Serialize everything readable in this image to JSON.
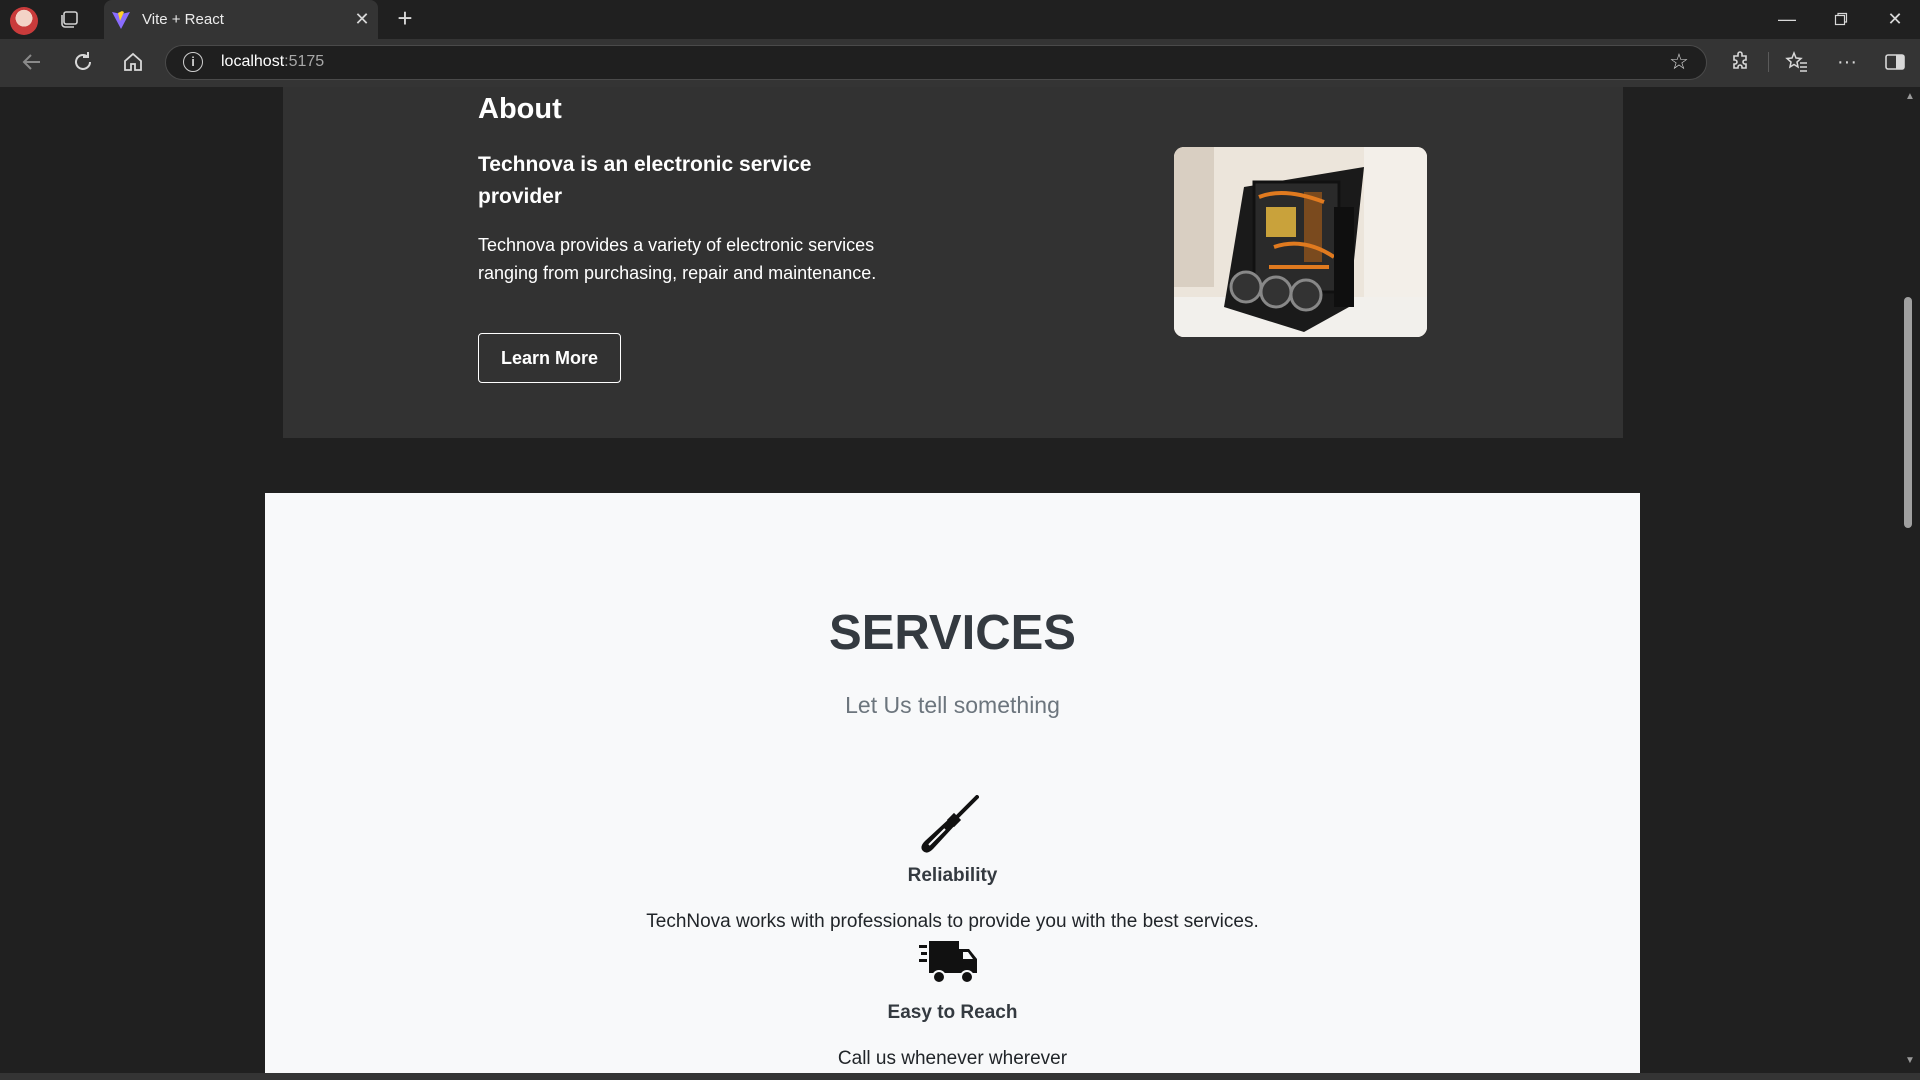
{
  "browser": {
    "tab_title": "Vite + React",
    "url_host": "localhost",
    "url_port": ":5175",
    "icons": [
      "profile-avatar",
      "tab-actions-icon",
      "vite-favicon",
      "close-icon",
      "plus-icon",
      "minimize-icon",
      "restore-icon",
      "window-close-icon",
      "back-arrow-icon",
      "refresh-icon",
      "home-icon",
      "info-icon",
      "star-icon",
      "extensions-icon",
      "favorites-icon",
      "more-icon",
      "sidebar-icon"
    ]
  },
  "about": {
    "heading": "About",
    "subheading": "Technova is an electronic service provider",
    "description": "Technova provides a variety of electronic services ranging from purchasing, repair and maintenance.",
    "button_label": "Learn More"
  },
  "services": {
    "title": "SERVICES",
    "subtitle": "Let Us tell something",
    "features": [
      {
        "icon": "screwdriver-icon",
        "title": "Reliability",
        "text": "TechNova works with professionals to provide you with the best services."
      },
      {
        "icon": "fast-truck-icon",
        "title": "Easy to Reach",
        "text": "Call us whenever wherever"
      }
    ]
  },
  "colors": {
    "page_bg": "#202020",
    "about_bg": "#323232",
    "services_bg": "#f8f9fa",
    "heading_dark": "#343a40",
    "muted_text": "#6c757d"
  }
}
